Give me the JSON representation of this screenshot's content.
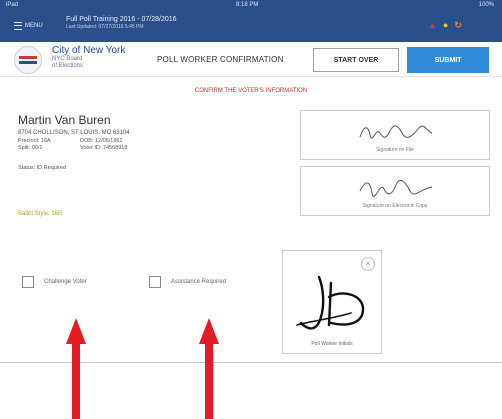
{
  "status_bar": {
    "carrier": "iPad",
    "time": "8:18 PM",
    "battery": "100%",
    "menu_label": "MENU",
    "title": "Full Poll Training 2016 - 07/28/2016",
    "subtitle": "Last Updated: 07/27/2016 5:45 PM",
    "icons": [
      "alert-icon",
      "signal-icon",
      "sync-icon"
    ]
  },
  "header": {
    "org_name": "City of New York",
    "org_sub1": "NYC Board",
    "org_sub2": "of Elections",
    "title": "POLL WORKER CONFIRMATION",
    "start_over_label": "START OVER",
    "submit_label": "SUBMIT"
  },
  "notice": "CONFIRM THE VOTER'S INFORMATION",
  "voter": {
    "name": "Martin Van Buren",
    "address": "8704 CHOLLISON, ST LOUIS, MO 63104",
    "details": [
      "Precinct: 16A",
      "DOB: 12/05/1962",
      "Split: 00/1",
      "Voter ID: 74568918"
    ],
    "status": "Status: ID Required",
    "ballot_type": "Ballot Style: 16R"
  },
  "signatures": {
    "file_caption": "Signature on File",
    "electronic_caption": "Signature on Electronic Copy",
    "poll_worker_caption": "Poll Worker Initials",
    "close_glyph": "×"
  },
  "checkboxes": {
    "challenge_label": "Challenge Voter",
    "assistance_label": "Assistance Required"
  },
  "colors": {
    "brand_blue": "#2b4f8a",
    "submit_blue": "#2f8ad8",
    "arrow_red": "#e31b23",
    "notice_red": "#c03a2e"
  }
}
